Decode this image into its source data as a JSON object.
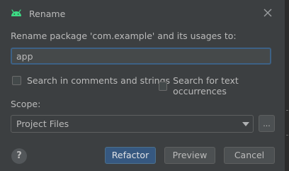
{
  "dialog": {
    "title": "Rename",
    "header_label": "Rename package 'com.example' and its usages to:",
    "name_value": "app",
    "options": {
      "search_comments_label": "Search in comments and strings",
      "search_text_label": "Search for text occurrences"
    },
    "scope": {
      "label": "Scope:",
      "selected": "Project Files",
      "browse_label": "..."
    },
    "buttons": {
      "help_label": "?",
      "refactor_label": "Refactor",
      "preview_label": "Preview",
      "cancel_label": "Cancel"
    },
    "icons": {
      "title_icon": "android-icon",
      "close": "close-icon",
      "dropdown": "chevron-down-icon"
    },
    "colors": {
      "background": "#3c3f41",
      "primary_button": "#365880",
      "focus_border": "#3d6185",
      "android_green": "#3ddc84"
    }
  }
}
